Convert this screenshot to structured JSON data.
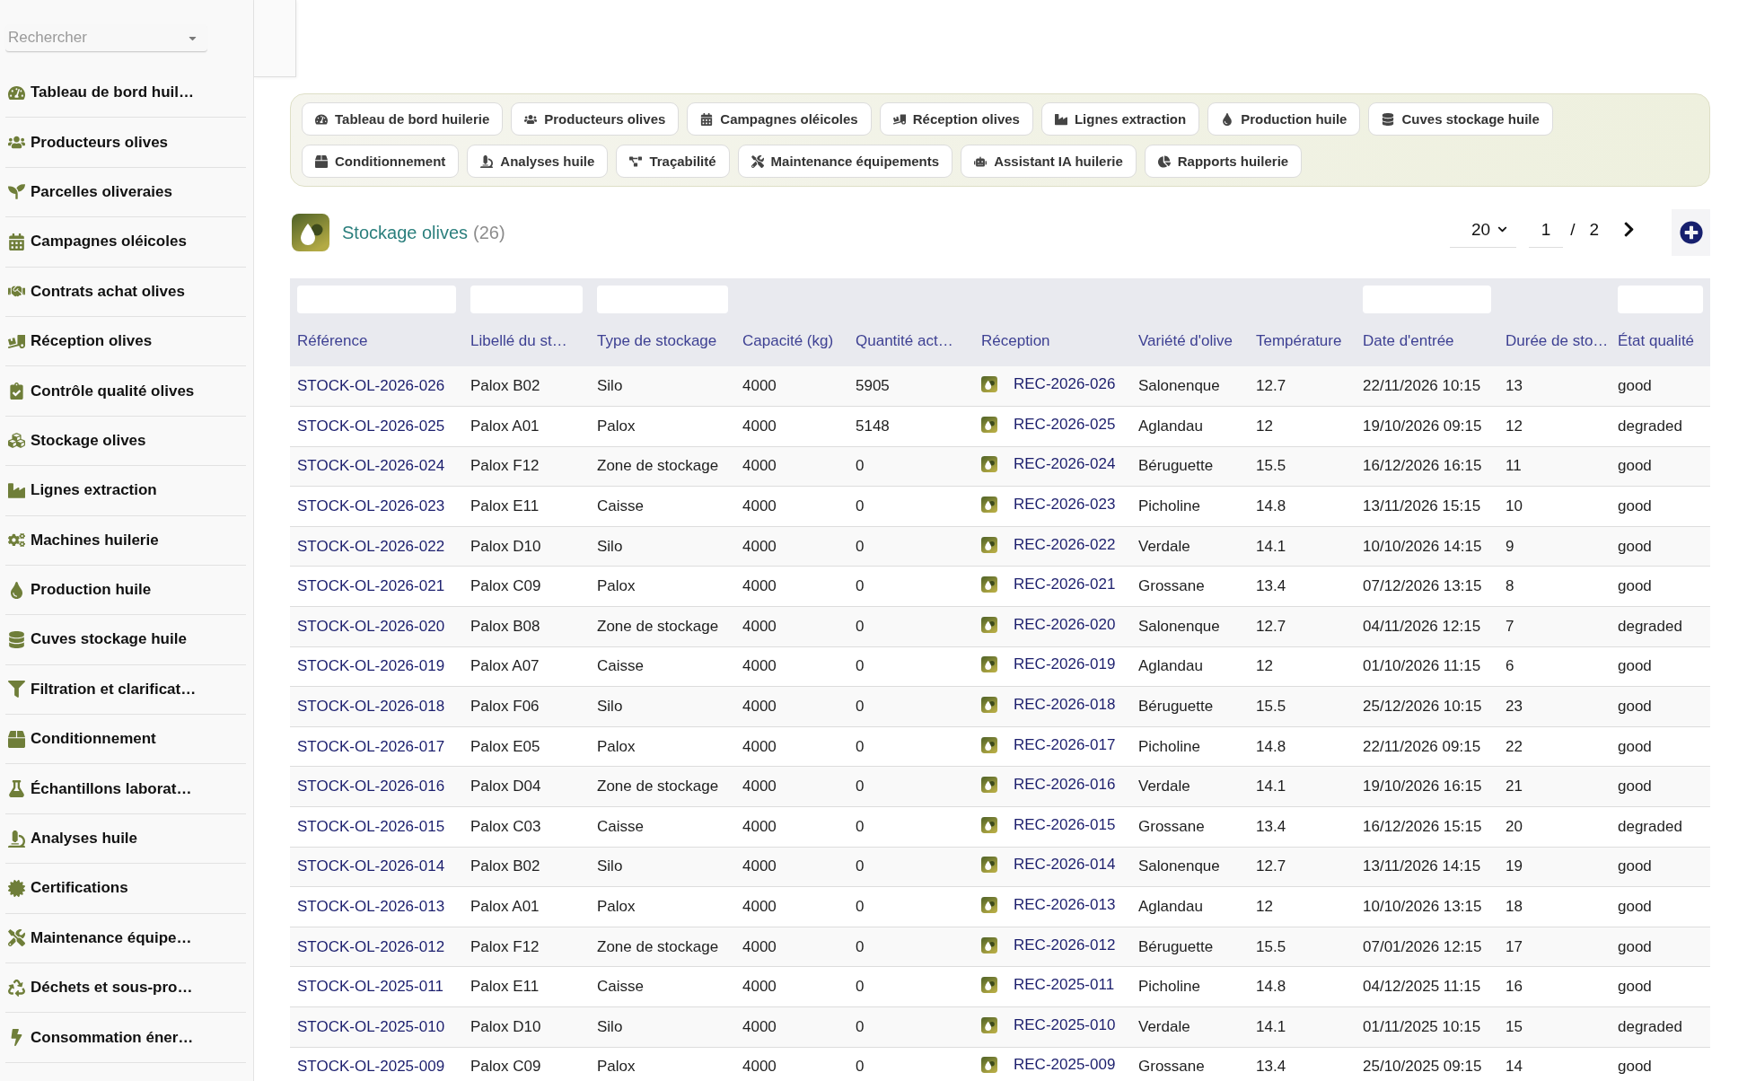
{
  "sidebar": {
    "search": {
      "placeholder": "Rechercher"
    },
    "items": [
      {
        "label": "Tableau de bord huil…"
      },
      {
        "label": "Producteurs olives"
      },
      {
        "label": "Parcelles oliveraies"
      },
      {
        "label": "Campagnes oléicoles"
      },
      {
        "label": "Contrats achat olives"
      },
      {
        "label": "Réception olives"
      },
      {
        "label": "Contrôle qualité olives"
      },
      {
        "label": "Stockage olives"
      },
      {
        "label": "Lignes extraction"
      },
      {
        "label": "Machines huilerie"
      },
      {
        "label": "Production huile"
      },
      {
        "label": "Cuves stockage huile"
      },
      {
        "label": "Filtration et clarificat…"
      },
      {
        "label": "Conditionnement"
      },
      {
        "label": "Échantillons laborat…"
      },
      {
        "label": "Analyses huile"
      },
      {
        "label": "Certifications"
      },
      {
        "label": "Maintenance équipe…"
      },
      {
        "label": "Déchets et sous-pro…"
      },
      {
        "label": "Consommation éner…"
      }
    ]
  },
  "shortcuts": [
    {
      "label": "Tableau de bord huilerie"
    },
    {
      "label": "Producteurs olives"
    },
    {
      "label": "Campagnes oléicoles"
    },
    {
      "label": "Réception olives"
    },
    {
      "label": "Lignes extraction"
    },
    {
      "label": "Production huile"
    },
    {
      "label": "Cuves stockage huile"
    },
    {
      "label": "Conditionnement"
    },
    {
      "label": "Analyses huile"
    },
    {
      "label": "Traçabilité"
    },
    {
      "label": "Maintenance équipements"
    },
    {
      "label": "Assistant IA huilerie"
    },
    {
      "label": "Rapports huilerie"
    }
  ],
  "header": {
    "title": "Stockage olives",
    "count": "(26)"
  },
  "pagination": {
    "page_size": "20",
    "page": "1",
    "separator": "/",
    "page_count": "2"
  },
  "table": {
    "columns": [
      {
        "label": "Référence",
        "kind": "link",
        "filter": true
      },
      {
        "label": "Libellé du st…",
        "kind": "text",
        "filter": true
      },
      {
        "label": "Type de stockage",
        "kind": "text",
        "filter": true
      },
      {
        "label": "Capacité (kg)",
        "kind": "text",
        "filter": false
      },
      {
        "label": "Quantité act…",
        "kind": "text",
        "filter": false
      },
      {
        "label": "Réception",
        "kind": "icon_link",
        "filter": false
      },
      {
        "label": "Variété d'olive",
        "kind": "text",
        "filter": false
      },
      {
        "label": "Température",
        "kind": "text",
        "filter": false
      },
      {
        "label": "Date d'entrée",
        "kind": "text",
        "filter": true
      },
      {
        "label": "Durée de sto…",
        "kind": "text",
        "filter": false
      },
      {
        "label": "État qualité",
        "kind": "text",
        "filter": true
      }
    ],
    "rows": [
      [
        "STOCK-OL-2026-026",
        "Palox B02",
        "Silo",
        "4000",
        "5905",
        "REC-2026-026",
        "Salonenque",
        "12.7",
        "22/11/2026 10:15",
        "13",
        "good"
      ],
      [
        "STOCK-OL-2026-025",
        "Palox A01",
        "Palox",
        "4000",
        "5148",
        "REC-2026-025",
        "Aglandau",
        "12",
        "19/10/2026 09:15",
        "12",
        "degraded"
      ],
      [
        "STOCK-OL-2026-024",
        "Palox F12",
        "Zone de stockage",
        "4000",
        "0",
        "REC-2026-024",
        "Béruguette",
        "15.5",
        "16/12/2026 16:15",
        "11",
        "good"
      ],
      [
        "STOCK-OL-2026-023",
        "Palox E11",
        "Caisse",
        "4000",
        "0",
        "REC-2026-023",
        "Picholine",
        "14.8",
        "13/11/2026 15:15",
        "10",
        "good"
      ],
      [
        "STOCK-OL-2026-022",
        "Palox D10",
        "Silo",
        "4000",
        "0",
        "REC-2026-022",
        "Verdale",
        "14.1",
        "10/10/2026 14:15",
        "9",
        "good"
      ],
      [
        "STOCK-OL-2026-021",
        "Palox C09",
        "Palox",
        "4000",
        "0",
        "REC-2026-021",
        "Grossane",
        "13.4",
        "07/12/2026 13:15",
        "8",
        "good"
      ],
      [
        "STOCK-OL-2026-020",
        "Palox B08",
        "Zone de stockage",
        "4000",
        "0",
        "REC-2026-020",
        "Salonenque",
        "12.7",
        "04/11/2026 12:15",
        "7",
        "degraded"
      ],
      [
        "STOCK-OL-2026-019",
        "Palox A07",
        "Caisse",
        "4000",
        "0",
        "REC-2026-019",
        "Aglandau",
        "12",
        "01/10/2026 11:15",
        "6",
        "good"
      ],
      [
        "STOCK-OL-2026-018",
        "Palox F06",
        "Silo",
        "4000",
        "0",
        "REC-2026-018",
        "Béruguette",
        "15.5",
        "25/12/2026 10:15",
        "23",
        "good"
      ],
      [
        "STOCK-OL-2026-017",
        "Palox E05",
        "Palox",
        "4000",
        "0",
        "REC-2026-017",
        "Picholine",
        "14.8",
        "22/11/2026 09:15",
        "22",
        "good"
      ],
      [
        "STOCK-OL-2026-016",
        "Palox D04",
        "Zone de stockage",
        "4000",
        "0",
        "REC-2026-016",
        "Verdale",
        "14.1",
        "19/10/2026 16:15",
        "21",
        "good"
      ],
      [
        "STOCK-OL-2026-015",
        "Palox C03",
        "Caisse",
        "4000",
        "0",
        "REC-2026-015",
        "Grossane",
        "13.4",
        "16/12/2026 15:15",
        "20",
        "degraded"
      ],
      [
        "STOCK-OL-2026-014",
        "Palox B02",
        "Silo",
        "4000",
        "0",
        "REC-2026-014",
        "Salonenque",
        "12.7",
        "13/11/2026 14:15",
        "19",
        "good"
      ],
      [
        "STOCK-OL-2026-013",
        "Palox A01",
        "Palox",
        "4000",
        "0",
        "REC-2026-013",
        "Aglandau",
        "12",
        "10/10/2026 13:15",
        "18",
        "good"
      ],
      [
        "STOCK-OL-2026-012",
        "Palox F12",
        "Zone de stockage",
        "4000",
        "0",
        "REC-2026-012",
        "Béruguette",
        "15.5",
        "07/01/2026 12:15",
        "17",
        "good"
      ],
      [
        "STOCK-OL-2025-011",
        "Palox E11",
        "Caisse",
        "4000",
        "0",
        "REC-2025-011",
        "Picholine",
        "14.8",
        "04/12/2025 11:15",
        "16",
        "good"
      ],
      [
        "STOCK-OL-2025-010",
        "Palox D10",
        "Silo",
        "4000",
        "0",
        "REC-2025-010",
        "Verdale",
        "14.1",
        "01/11/2025 10:15",
        "15",
        "degraded"
      ],
      [
        "STOCK-OL-2025-009",
        "Palox C09",
        "Palox",
        "4000",
        "0",
        "REC-2025-009",
        "Grossane",
        "13.4",
        "25/10/2025 09:15",
        "14",
        "good"
      ]
    ]
  }
}
